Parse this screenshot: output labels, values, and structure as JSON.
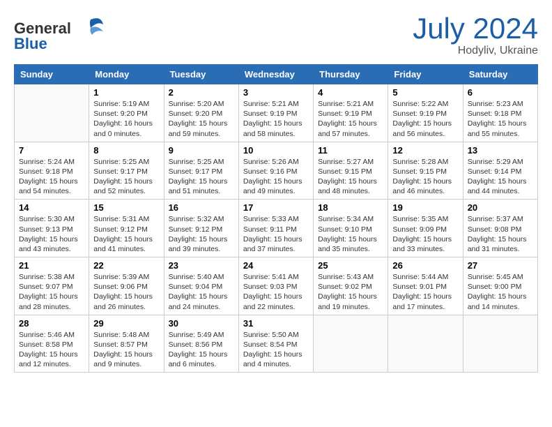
{
  "header": {
    "logo": {
      "general": "General",
      "blue": "Blue"
    },
    "title": "July 2024",
    "location": "Hodyliv, Ukraine"
  },
  "weekdays": [
    "Sunday",
    "Monday",
    "Tuesday",
    "Wednesday",
    "Thursday",
    "Friday",
    "Saturday"
  ],
  "weeks": [
    [
      {
        "day": "",
        "info": ""
      },
      {
        "day": "1",
        "info": "Sunrise: 5:19 AM\nSunset: 9:20 PM\nDaylight: 16 hours\nand 0 minutes."
      },
      {
        "day": "2",
        "info": "Sunrise: 5:20 AM\nSunset: 9:20 PM\nDaylight: 15 hours\nand 59 minutes."
      },
      {
        "day": "3",
        "info": "Sunrise: 5:21 AM\nSunset: 9:19 PM\nDaylight: 15 hours\nand 58 minutes."
      },
      {
        "day": "4",
        "info": "Sunrise: 5:21 AM\nSunset: 9:19 PM\nDaylight: 15 hours\nand 57 minutes."
      },
      {
        "day": "5",
        "info": "Sunrise: 5:22 AM\nSunset: 9:19 PM\nDaylight: 15 hours\nand 56 minutes."
      },
      {
        "day": "6",
        "info": "Sunrise: 5:23 AM\nSunset: 9:18 PM\nDaylight: 15 hours\nand 55 minutes."
      }
    ],
    [
      {
        "day": "7",
        "info": "Sunrise: 5:24 AM\nSunset: 9:18 PM\nDaylight: 15 hours\nand 54 minutes."
      },
      {
        "day": "8",
        "info": "Sunrise: 5:25 AM\nSunset: 9:17 PM\nDaylight: 15 hours\nand 52 minutes."
      },
      {
        "day": "9",
        "info": "Sunrise: 5:25 AM\nSunset: 9:17 PM\nDaylight: 15 hours\nand 51 minutes."
      },
      {
        "day": "10",
        "info": "Sunrise: 5:26 AM\nSunset: 9:16 PM\nDaylight: 15 hours\nand 49 minutes."
      },
      {
        "day": "11",
        "info": "Sunrise: 5:27 AM\nSunset: 9:15 PM\nDaylight: 15 hours\nand 48 minutes."
      },
      {
        "day": "12",
        "info": "Sunrise: 5:28 AM\nSunset: 9:15 PM\nDaylight: 15 hours\nand 46 minutes."
      },
      {
        "day": "13",
        "info": "Sunrise: 5:29 AM\nSunset: 9:14 PM\nDaylight: 15 hours\nand 44 minutes."
      }
    ],
    [
      {
        "day": "14",
        "info": "Sunrise: 5:30 AM\nSunset: 9:13 PM\nDaylight: 15 hours\nand 43 minutes."
      },
      {
        "day": "15",
        "info": "Sunrise: 5:31 AM\nSunset: 9:12 PM\nDaylight: 15 hours\nand 41 minutes."
      },
      {
        "day": "16",
        "info": "Sunrise: 5:32 AM\nSunset: 9:12 PM\nDaylight: 15 hours\nand 39 minutes."
      },
      {
        "day": "17",
        "info": "Sunrise: 5:33 AM\nSunset: 9:11 PM\nDaylight: 15 hours\nand 37 minutes."
      },
      {
        "day": "18",
        "info": "Sunrise: 5:34 AM\nSunset: 9:10 PM\nDaylight: 15 hours\nand 35 minutes."
      },
      {
        "day": "19",
        "info": "Sunrise: 5:35 AM\nSunset: 9:09 PM\nDaylight: 15 hours\nand 33 minutes."
      },
      {
        "day": "20",
        "info": "Sunrise: 5:37 AM\nSunset: 9:08 PM\nDaylight: 15 hours\nand 31 minutes."
      }
    ],
    [
      {
        "day": "21",
        "info": "Sunrise: 5:38 AM\nSunset: 9:07 PM\nDaylight: 15 hours\nand 28 minutes."
      },
      {
        "day": "22",
        "info": "Sunrise: 5:39 AM\nSunset: 9:06 PM\nDaylight: 15 hours\nand 26 minutes."
      },
      {
        "day": "23",
        "info": "Sunrise: 5:40 AM\nSunset: 9:04 PM\nDaylight: 15 hours\nand 24 minutes."
      },
      {
        "day": "24",
        "info": "Sunrise: 5:41 AM\nSunset: 9:03 PM\nDaylight: 15 hours\nand 22 minutes."
      },
      {
        "day": "25",
        "info": "Sunrise: 5:43 AM\nSunset: 9:02 PM\nDaylight: 15 hours\nand 19 minutes."
      },
      {
        "day": "26",
        "info": "Sunrise: 5:44 AM\nSunset: 9:01 PM\nDaylight: 15 hours\nand 17 minutes."
      },
      {
        "day": "27",
        "info": "Sunrise: 5:45 AM\nSunset: 9:00 PM\nDaylight: 15 hours\nand 14 minutes."
      }
    ],
    [
      {
        "day": "28",
        "info": "Sunrise: 5:46 AM\nSunset: 8:58 PM\nDaylight: 15 hours\nand 12 minutes."
      },
      {
        "day": "29",
        "info": "Sunrise: 5:48 AM\nSunset: 8:57 PM\nDaylight: 15 hours\nand 9 minutes."
      },
      {
        "day": "30",
        "info": "Sunrise: 5:49 AM\nSunset: 8:56 PM\nDaylight: 15 hours\nand 6 minutes."
      },
      {
        "day": "31",
        "info": "Sunrise: 5:50 AM\nSunset: 8:54 PM\nDaylight: 15 hours\nand 4 minutes."
      },
      {
        "day": "",
        "info": ""
      },
      {
        "day": "",
        "info": ""
      },
      {
        "day": "",
        "info": ""
      }
    ]
  ]
}
